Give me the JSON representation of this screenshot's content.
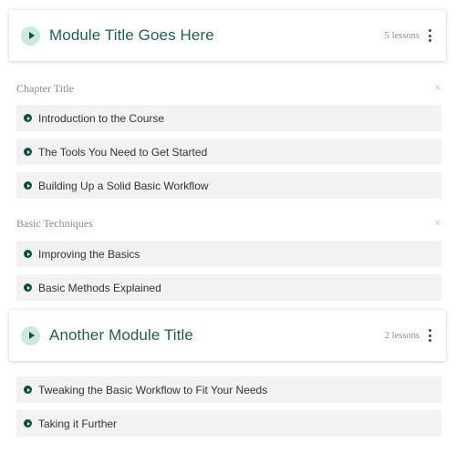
{
  "colors": {
    "accent": "#1f5f56",
    "badge_bg": "#cde8e2",
    "dot": "#0d4f44",
    "lesson_bg": "#f2f2f2",
    "muted": "#8a8a8a"
  },
  "modules": [
    {
      "title": "Module Title Goes Here",
      "lessons_count": "5 lessons",
      "play_icon": "play-icon",
      "menu_icon": "kebab-menu-icon",
      "chapters": [
        {
          "title": "Chapter Title",
          "close_icon": "×",
          "lessons": [
            {
              "label": "Introduction to the Course"
            },
            {
              "label": "The Tools You Need to Get Started"
            },
            {
              "label": "Building Up a Solid Basic Workflow"
            }
          ]
        },
        {
          "title": "Basic Techniques",
          "close_icon": "×",
          "lessons": [
            {
              "label": "Improving the Basics"
            },
            {
              "label": "Basic Methods Explained"
            }
          ]
        }
      ]
    },
    {
      "title": "Another Module Title",
      "lessons_count": "2 lessons",
      "play_icon": "play-icon",
      "menu_icon": "kebab-menu-icon",
      "lessons": [
        {
          "label": "Tweaking the Basic Workflow to Fit Your Needs"
        },
        {
          "label": "Taking it Further"
        }
      ]
    }
  ]
}
